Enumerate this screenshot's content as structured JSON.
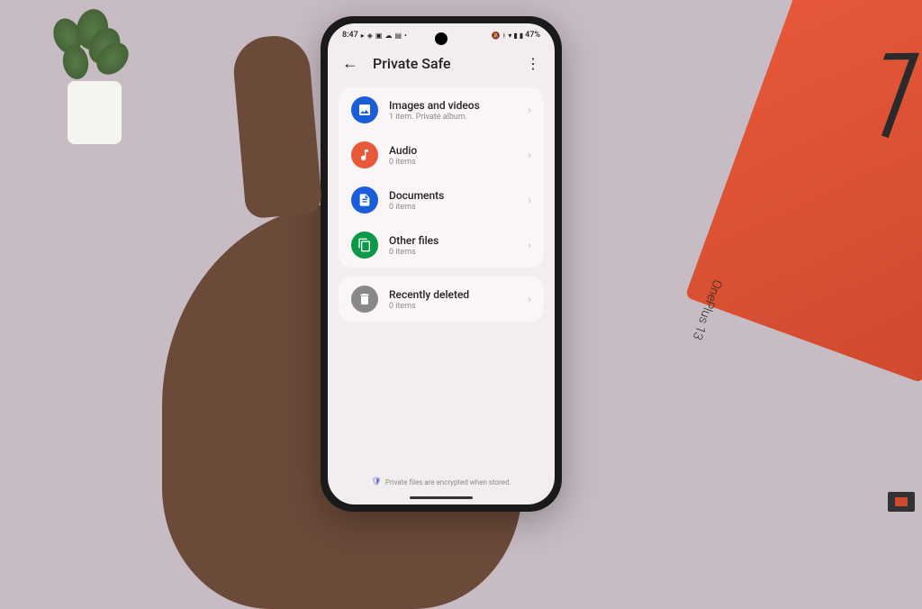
{
  "status": {
    "time": "8:47",
    "battery": "47%"
  },
  "header": {
    "title": "Private Safe"
  },
  "categories": [
    {
      "title": "Images and videos",
      "subtitle": "1 item. Private album.",
      "iconColor": "#1a5dd8",
      "icon": "images"
    },
    {
      "title": "Audio",
      "subtitle": "0 items",
      "iconColor": "#e8593a",
      "icon": "audio"
    },
    {
      "title": "Documents",
      "subtitle": "0 items",
      "iconColor": "#1a5dd8",
      "icon": "documents"
    },
    {
      "title": "Other files",
      "subtitle": "0 items",
      "iconColor": "#0a9948",
      "icon": "files"
    }
  ],
  "deleted": {
    "title": "Recently deleted",
    "subtitle": "0 items",
    "iconColor": "#888888"
  },
  "footer": {
    "text": "Private files are encrypted when stored."
  },
  "box": {
    "brand": "OnePlus 13",
    "number": "13"
  }
}
